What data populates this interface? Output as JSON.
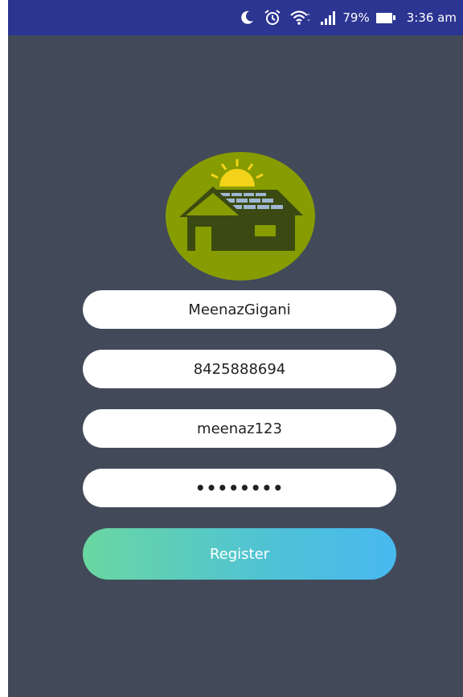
{
  "status_bar": {
    "battery_percent": "79%",
    "time": "3:36 am",
    "icons": [
      "moon-icon",
      "alarm-icon",
      "wifi-icon",
      "signal-icon",
      "battery-icon"
    ],
    "background_color": "#2c3591"
  },
  "logo": {
    "icon": "solar-house-icon",
    "circle_color": "#869c00",
    "house_color": "#3b4a12",
    "sun_color": "#f2d21a"
  },
  "form": {
    "name_value": "MeenazGigani",
    "phone_value": "8425888694",
    "username_value": "meenaz123",
    "password_value": "••••••••",
    "register_label": "Register"
  },
  "theme": {
    "background": "#424a5a",
    "button_gradient": [
      "#6ad7a0",
      "#48b9ef"
    ]
  }
}
